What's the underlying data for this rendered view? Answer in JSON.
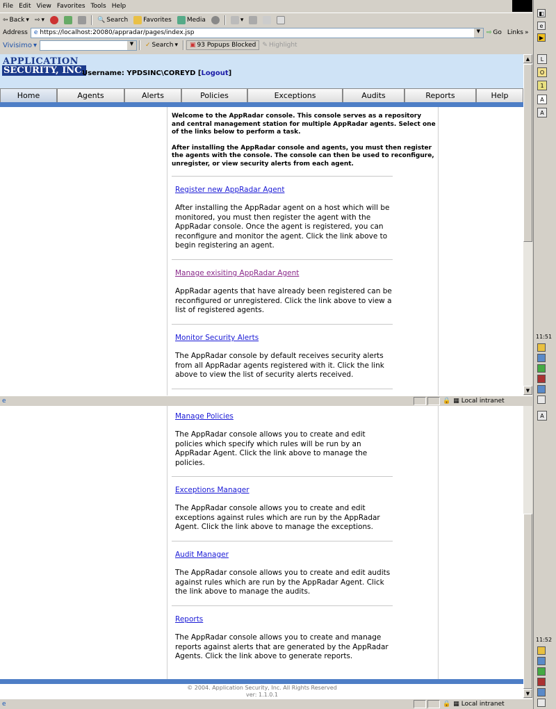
{
  "menu": {
    "items": [
      "File",
      "Edit",
      "View",
      "Favorites",
      "Tools",
      "Help"
    ]
  },
  "toolbar": {
    "back": "Back",
    "search": "Search",
    "favorites": "Favorites",
    "media": "Media"
  },
  "address": {
    "label": "Address",
    "url": "https://localhost:20080/appradar/pages/index.jsp",
    "go": "Go",
    "links": "Links"
  },
  "searchbar": {
    "brand": "Vivisimo",
    "search": "Search",
    "popups": "93 Popups Blocked",
    "highlight": "Highlight"
  },
  "header": {
    "logo_line1": "Application",
    "logo_line2": "Security, Inc.",
    "username_label": "Username: YPDSINC\\COREYD [",
    "logout": "Logout",
    "username_close": "]"
  },
  "tabs": [
    "Home",
    "Agents",
    "Alerts",
    "Policies",
    "Exceptions",
    "Audits",
    "Reports",
    "Help"
  ],
  "intro": {
    "p1": "Welcome to the AppRadar console. This console serves as a repository and central management station for multiple AppRadar agents. Select one of the links below to perform a task.",
    "p2": "After installing the AppRadar console and agents, you must then register the agents with the console. The console can then be used to reconfigure, unregister, or view security alerts from each agent."
  },
  "items": [
    {
      "link": "Register new AppRadar Agent",
      "desc": "After installing the AppRadar agent on a host which will be monitored, you must then register the agent with the AppRadar console. Once the agent is registered, you can reconfigure and monitor the agent. Click the link above to begin registering an agent."
    },
    {
      "link": "Manage exisiting AppRadar Agent",
      "desc": "AppRadar agents that have already been registered can be reconfigured or unregistered. Click the link above to view a list of registered agents."
    },
    {
      "link": "Monitor Security Alerts",
      "desc": "The AppRadar console by default receives security alerts from all AppRadar agents registered with it. Click the link above to view the list of security alerts received."
    },
    {
      "link": "Manage Policies",
      "desc": "The AppRadar console allows you to create and edit policies which specify which rules will be run by an AppRadar Agent. Click the link above to manage the policies."
    },
    {
      "link": "Exceptions Manager",
      "desc": "The AppRadar console allows you to create and edit exceptions against rules which are run by the AppRadar Agent. Click the link above to manage the exceptions."
    },
    {
      "link": "Audit Manager",
      "desc": "The AppRadar console allows you to create and edit audits against rules which are run by the AppRadar Agent. Click the link above to manage the audits."
    },
    {
      "link": "Reports",
      "desc": "The AppRadar console allows you to create and manage reports against alerts that are generated by the AppRadar Agents. Click the link above to generate reports."
    }
  ],
  "footer": {
    "copyright": "© 2004. Application Security, Inc. All Rights Reserved",
    "version": "ver: 1.1.0.1"
  },
  "status": {
    "zone": "Local intranet"
  },
  "clock": {
    "t1": "11:51",
    "t2": "11:52"
  },
  "colors": {
    "header_bg": "#cfe3f6",
    "blue_band": "#4e7ec6",
    "link": "#1a1ad6",
    "visited": "#8a2a8a",
    "logo": "#1c3a8c"
  }
}
